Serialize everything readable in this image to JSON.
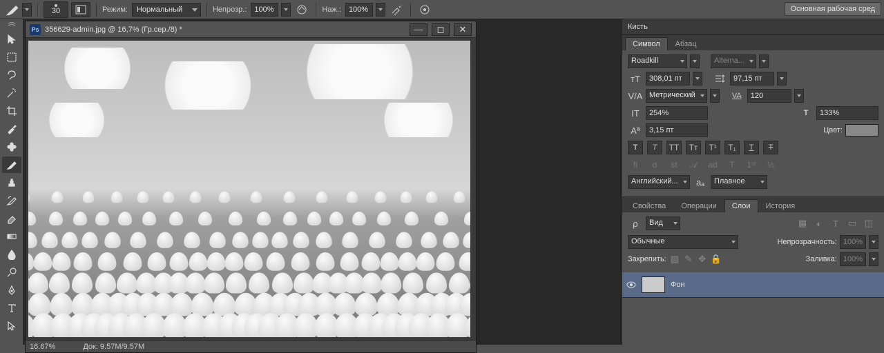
{
  "options_bar": {
    "brush_size": "30",
    "mode_label": "Режим:",
    "mode_value": "Нормальный",
    "opacity_label": "Непрозр.:",
    "opacity_value": "100%",
    "flow_label": "Наж.:",
    "flow_value": "100%",
    "workspace_button": "Основная рабочая сред"
  },
  "document": {
    "title": "356629-admin.jpg @ 16,7% (Гр.сер./8) *",
    "zoom": "16.67%",
    "doc_info": "Док: 9.57M/9.57M"
  },
  "panels": {
    "brush_tab": "Кисть",
    "character_tab": "Символ",
    "paragraph_tab": "Абзац",
    "font_family": "Roadkill",
    "font_style": "Alterna...",
    "font_size": "308,01 пт",
    "leading": "97,15 пт",
    "kerning": "Метрический",
    "tracking": "120",
    "vscale": "254%",
    "hscale": "133%",
    "baseline": "3,15 пт",
    "color_label": "Цвет:",
    "language": "Английский...",
    "antialias": "Плавное",
    "properties_tab": "Свойства",
    "actions_tab": "Операции",
    "layers_tab": "Слои",
    "history_tab": "История",
    "kind_label": "Вид",
    "blend_mode": "Обычные",
    "layer_opacity_label": "Непрозрачность:",
    "layer_opacity": "100%",
    "lock_label": "Закрепить:",
    "fill_label": "Заливка:",
    "fill_value": "100%",
    "layer_name": "Фон"
  }
}
